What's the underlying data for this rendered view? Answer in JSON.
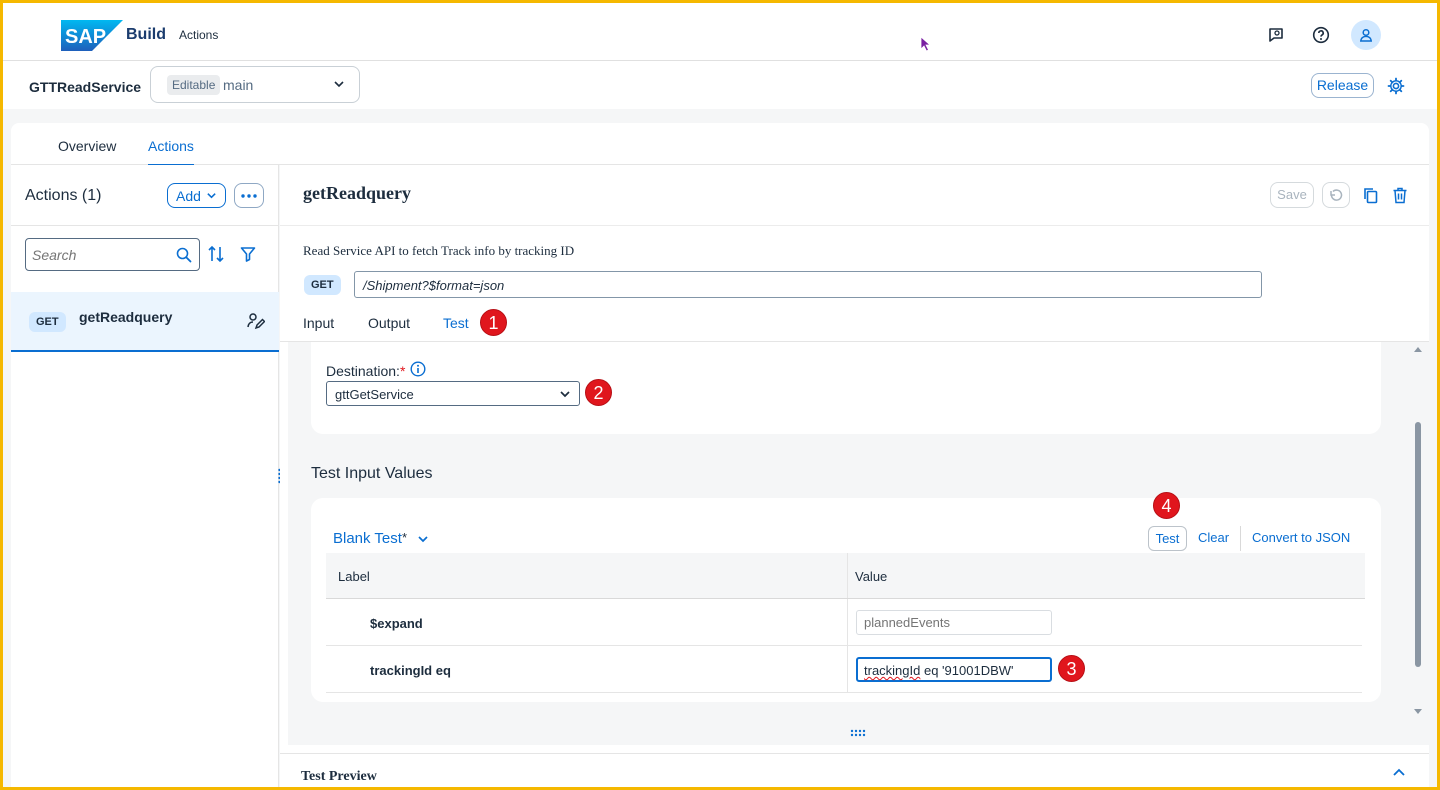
{
  "shell": {
    "logo_text": "SAP",
    "product": "Build",
    "section": "Actions",
    "icons": [
      "feedback-icon",
      "help-icon",
      "user-avatar-icon"
    ]
  },
  "project": {
    "name": "GTTReadService",
    "branch_tag": "Editable",
    "branch": "main",
    "release_label": "Release"
  },
  "top_tabs": [
    {
      "label": "Overview",
      "active": false
    },
    {
      "label": "Actions",
      "active": true
    }
  ],
  "left_pane": {
    "title": "Actions (1)",
    "add_label": "Add",
    "search_placeholder": "Search",
    "items": [
      {
        "method": "GET",
        "name": "getReadquery"
      }
    ]
  },
  "action": {
    "title": "getReadquery",
    "save_label": "Save",
    "description": "Read Service API to fetch Track info by tracking ID",
    "method": "GET",
    "url": "/Shipment?$format=json",
    "tabs": [
      {
        "label": "Input",
        "active": false
      },
      {
        "label": "Output",
        "active": false
      },
      {
        "label": "Test",
        "active": true
      }
    ]
  },
  "test": {
    "destination_label": "Destination:",
    "required_mark": "*",
    "destination_value": "gttGetService",
    "input_values_title": "Test Input Values",
    "test_set": "Blank Test",
    "test_set_modified": "*",
    "test_button": "Test",
    "clear_label": "Clear",
    "convert_label": "Convert to JSON",
    "columns": [
      "Label",
      "Value"
    ],
    "rows": [
      {
        "label": "$expand",
        "value": "",
        "placeholder": "plannedEvents",
        "focused": false
      },
      {
        "label": "trackingId eq",
        "value_prefix": "trackingId",
        "value_suffix": " eq '91001DBW'",
        "focused": true
      }
    ]
  },
  "preview": {
    "title": "Test Preview"
  },
  "annotations": [
    "1",
    "2",
    "3",
    "4"
  ],
  "colors": {
    "accent": "#0a6ed1",
    "marker": "#e0161d",
    "frame": "#f5b800"
  }
}
